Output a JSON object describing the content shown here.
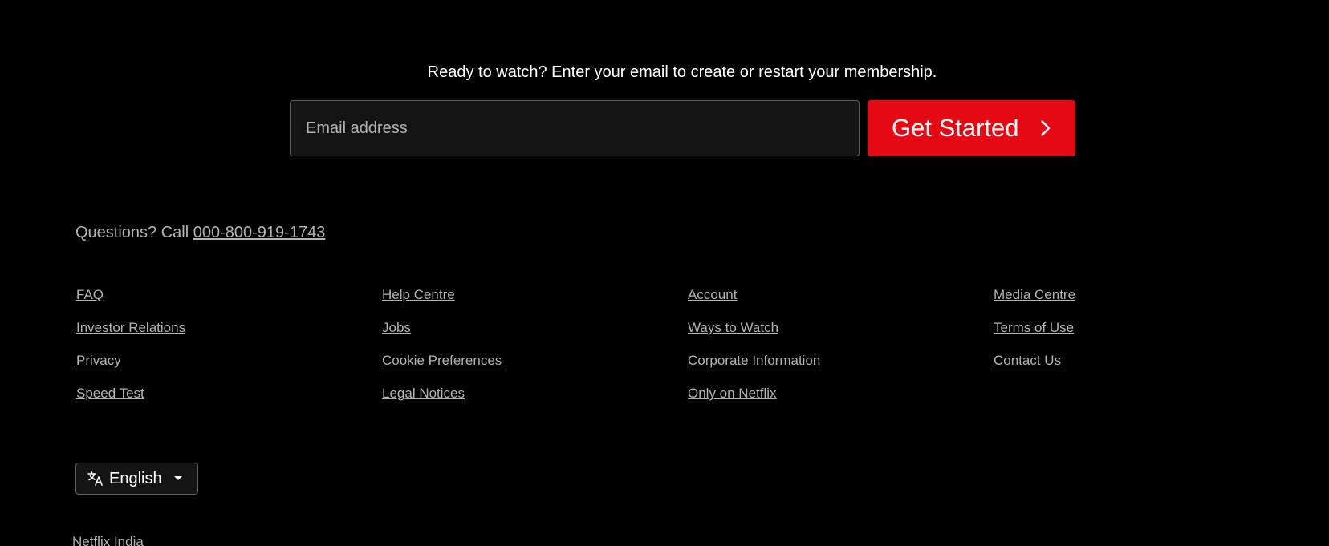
{
  "cta": {
    "text": "Ready to watch? Enter your email to create or restart your membership.",
    "email_placeholder": "Email address",
    "button_label": "Get Started",
    "button_color": "#e50914"
  },
  "questions": {
    "prefix": "Questions? Call ",
    "phone": "000-800-919-1743"
  },
  "footer_links": [
    "FAQ",
    "Help Centre",
    "Account",
    "Media Centre",
    "Investor Relations",
    "Jobs",
    "Ways to Watch",
    "Terms of Use",
    "Privacy",
    "Cookie Preferences",
    "Corporate Information",
    "Contact Us",
    "Speed Test",
    "Legal Notices",
    "Only on Netflix"
  ],
  "language": {
    "selected": "English",
    "icon": "languages-icon"
  },
  "brand": {
    "region": "Netflix India"
  }
}
